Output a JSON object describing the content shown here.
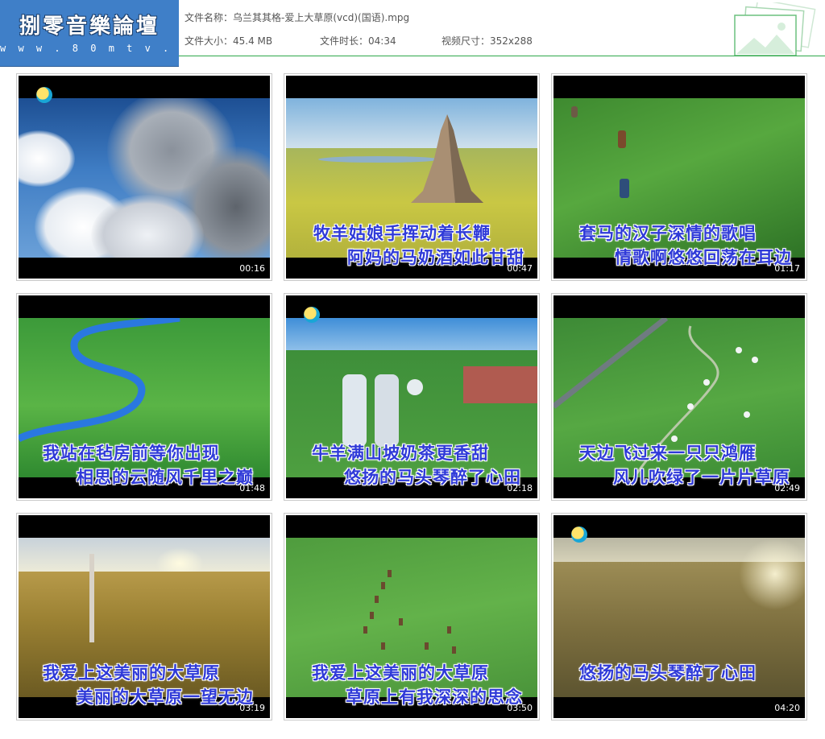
{
  "logo": {
    "title": "捌零音樂論壇",
    "url": "w w w . 8 0 m t v . c o m"
  },
  "file": {
    "name_label": "文件名称：",
    "name_value": "乌兰其其格-爱上大草原(vcd)(国语).mpg",
    "size_label": "文件大小：",
    "size_value": "45.4 MB",
    "duration_label": "文件时长：",
    "duration_value": "04:34",
    "dimensions_label": "视频尺寸：",
    "dimensions_value": "352x288"
  },
  "colors": {
    "header_blue": "#3f7fc8",
    "accent_green": "#2ea84a",
    "lyric_blue": "#2f3ad8"
  },
  "thumbnails": [
    {
      "timestamp": "00:16",
      "line1": "",
      "line2": ""
    },
    {
      "timestamp": "00:47",
      "line1": "牧羊姑娘手挥动着长鞭",
      "line2": "阿妈的马奶酒如此甘甜"
    },
    {
      "timestamp": "01:17",
      "line1": "套马的汉子深情的歌唱",
      "line2": "情歌啊悠悠回荡在耳边"
    },
    {
      "timestamp": "01:48",
      "line1": "我站在毡房前等你出现",
      "line2": "相思的云随风千里之巅"
    },
    {
      "timestamp": "02:18",
      "line1": "牛羊满山坡奶茶更香甜",
      "line2": "悠扬的马头琴醉了心田"
    },
    {
      "timestamp": "02:49",
      "line1": "天边飞过来一只只鸿雁",
      "line2": "风儿吹绿了一片片草原"
    },
    {
      "timestamp": "03:19",
      "line1": "我爱上这美丽的大草原",
      "line2": "美丽的大草原一望无边"
    },
    {
      "timestamp": "03:50",
      "line1": "我爱上这美丽的大草原",
      "line2": "草原上有我深深的思念"
    },
    {
      "timestamp": "04:20",
      "line1": "悠扬的马头琴醉了心田",
      "line2": ""
    }
  ]
}
